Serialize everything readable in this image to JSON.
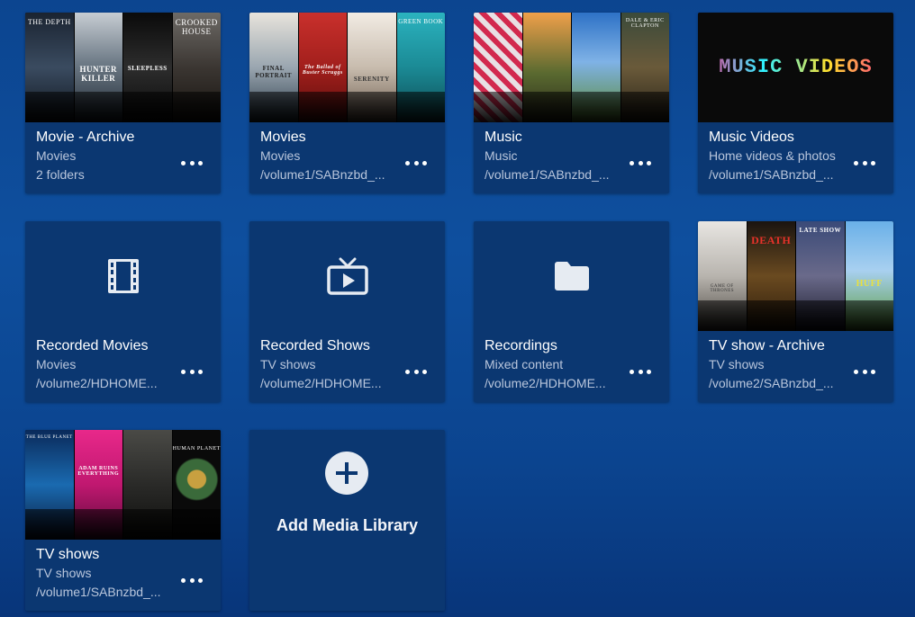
{
  "libraries": [
    {
      "title": "Movie - Archive",
      "type": "Movies",
      "path": "2 folders",
      "thumb_posters": [
        "THE DEPTH",
        "HUNTER KILLER",
        "SLEEPLESS",
        "CROOKED HOUSE"
      ]
    },
    {
      "title": "Movies",
      "type": "Movies",
      "path": "/volume1/SABnzbd_...",
      "thumb_posters": [
        "FINAL PORTRAIT",
        "The Ballad of Buster Scruggs",
        "SERENITY",
        "GREEN BOOK"
      ]
    },
    {
      "title": "Music",
      "type": "Music",
      "path": "/volume1/SABnzbd_...",
      "thumb_posters": [
        "",
        "",
        "",
        "DALE & ERIC CLAPTON"
      ]
    },
    {
      "title": "Music Videos",
      "type": "Home videos & photos",
      "path": "/volume1/SABnzbd_...",
      "thumb_text": "MUSIC VIDEOS"
    },
    {
      "title": "Recorded Movies",
      "type": "Movies",
      "path": "/volume2/HDHOME...",
      "icon": "film-icon"
    },
    {
      "title": "Recorded Shows",
      "type": "TV shows",
      "path": "/volume2/HDHOME...",
      "icon": "tv-icon"
    },
    {
      "title": "Recordings",
      "type": "Mixed content",
      "path": "/volume2/HDHOME...",
      "icon": "folder-icon"
    },
    {
      "title": "TV show - Archive",
      "type": "TV shows",
      "path": "/volume2/SABnzbd_...",
      "thumb_posters": [
        "GAME OF THRONES",
        "DEATH",
        "LATE SHOW",
        "HUFF"
      ]
    },
    {
      "title": "TV shows",
      "type": "TV shows",
      "path": "/volume1/SABnzbd_...",
      "thumb_posters": [
        "THE BLUE PLANET",
        "ADAM RUINS EVERYTHING",
        "",
        "HUMAN PLANET"
      ]
    }
  ],
  "add_library": {
    "label": "Add Media Library",
    "icon": "plus-icon"
  },
  "colors": {
    "card": "#0b3771",
    "background": "#0e4f9e",
    "accent_text": "#ffffff",
    "secondary_text": "#b9c6dc"
  }
}
